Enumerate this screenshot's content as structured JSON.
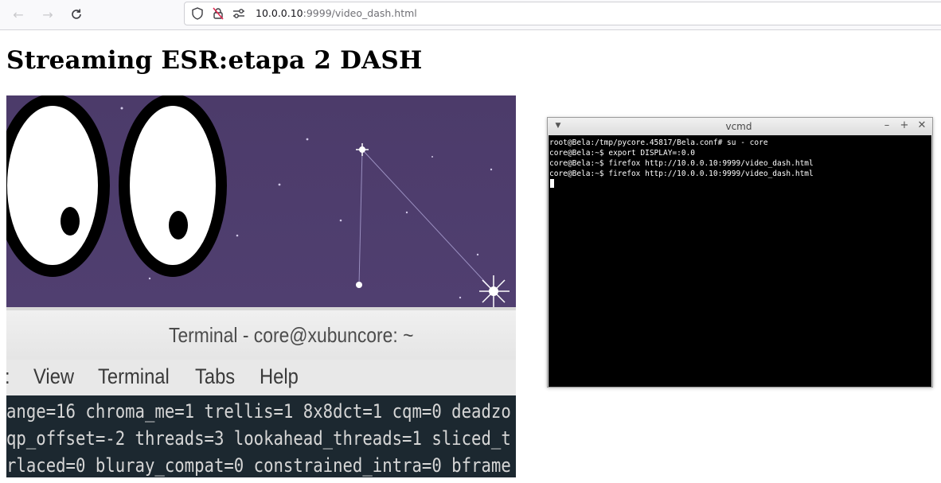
{
  "browser": {
    "nav": {
      "back_icon": "arrow-left-icon",
      "forward_icon": "arrow-right-icon",
      "reload_icon": "reload-icon"
    },
    "url_host": "10.0.0.10",
    "url_path": ":9999/video_dash.html",
    "security_icons": [
      "shield-icon",
      "insecure-lock-icon",
      "permissions-icon"
    ]
  },
  "page": {
    "title": "Streaming ESR:etapa 2 DASH"
  },
  "video": {
    "terminal_title": "Terminal - core@xubuncore: ~",
    "menu": [
      ":",
      "View",
      "Terminal",
      "Tabs",
      "Help"
    ],
    "lines": [
      "ange=16 chroma_me=1 trellis=1 8x8dct=1 cqm=0 deadzo",
      "qp_offset=-2 threads=3 lookahead_threads=1 sliced_t",
      "rlaced=0 bluray_compat=0 constrained_intra=0 bframe"
    ]
  },
  "vcmd": {
    "title": "vcmd",
    "lines": [
      "root@Bela:/tmp/pycore.45817/Bela.conf# su - core",
      "core@Bela:~$ export DISPLAY=:0.0",
      "core@Bela:~$ firefox http://10.0.0.10:9999/video_dash.html",
      "core@Bela:~$ firefox http://10.0.0.10:9999/video_dash.html"
    ]
  },
  "colors": {
    "sky": "#4c3b6a",
    "terminal_bg": "#000000",
    "video_terminal_bg": "#1c2830"
  }
}
